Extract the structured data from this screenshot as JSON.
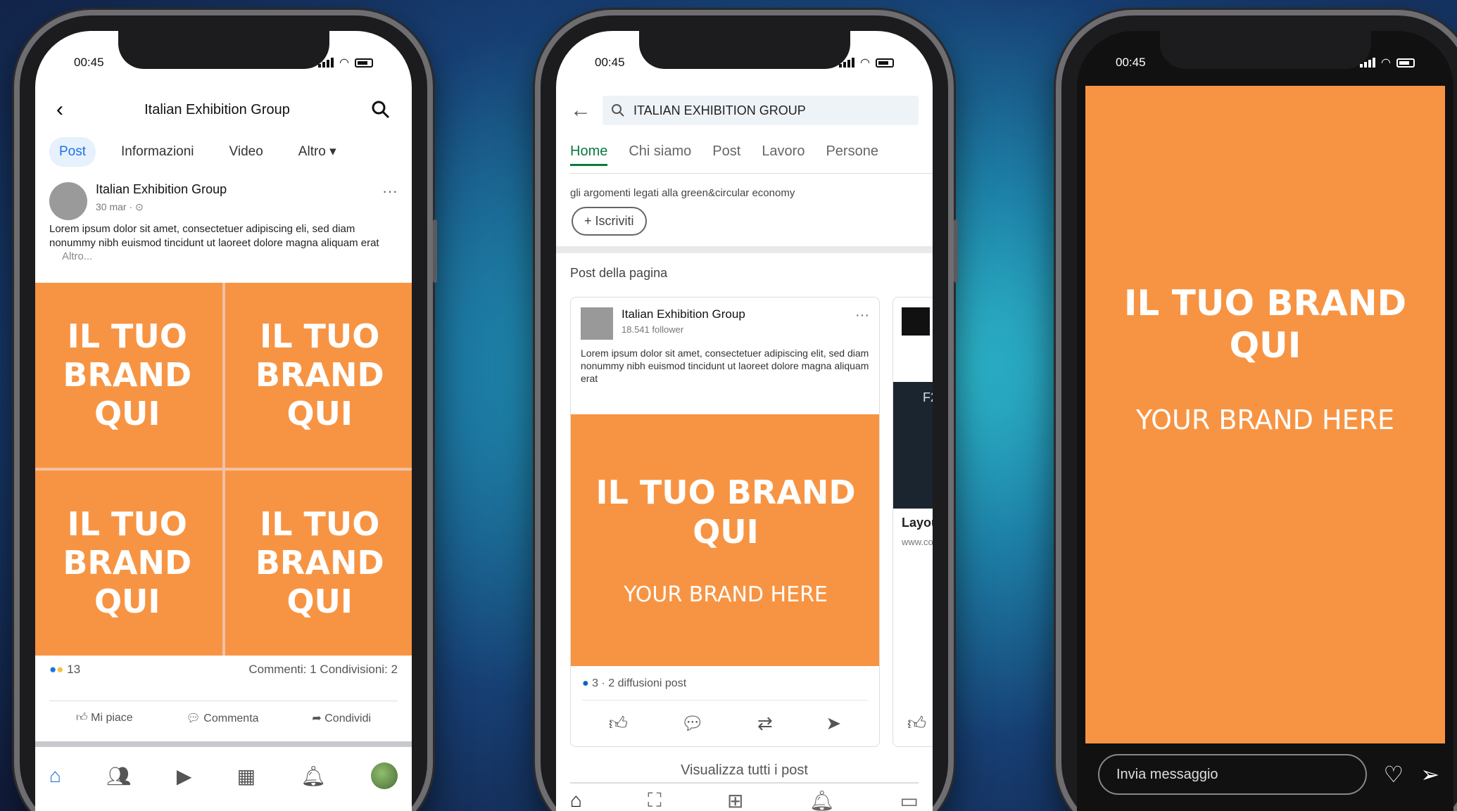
{
  "status": {
    "time": "00:45"
  },
  "facebook": {
    "page_title": "Italian Exhibition Group",
    "tabs": [
      "Post",
      "Informazioni",
      "Video",
      "Altro ▾"
    ],
    "post": {
      "author": "Italian Exhibition Group",
      "date": "30 mar · ⊙",
      "text": "Lorem ipsum dolor sit amet, consectetuer adipiscing eli, sed diam nonummy nibh euismod tincidunt ut laoreet dolore magna aliquam erat",
      "more": "Altro...",
      "brand_tiles": [
        "IL TUO BRAND QUI",
        "IL TUO BRAND QUI",
        "IL TUO BRAND QUI",
        "IL TUO BRAND QUI"
      ],
      "reactions": "13",
      "counts": "Commenti: 1   Condivisioni: 2"
    },
    "actions": [
      "Mi piace",
      "Commenta",
      "Condividi"
    ]
  },
  "linkedin": {
    "search_value": "ITALIAN EXHIBITION GROUP",
    "tabs": [
      "Home",
      "Chi siamo",
      "Post",
      "Lavoro",
      "Persone"
    ],
    "description": "gli argomenti legati alla green&circular economy",
    "follow_label": "+ Iscriviti",
    "section_title": "Post della pagina",
    "post": {
      "author": "Italian Exhibition Group",
      "followers": "18.541 follower",
      "text": "Lorem ipsum dolor sit amet, consectetuer adipiscing elit, sed diam nonummy nibh euismod tincidunt ut laoreet dolore magna aliquam erat",
      "brand_title": "IL TUO BRAND QUI",
      "brand_subtitle": "YOUR BRAND HERE",
      "stats": "3  ·  2 diffusioni post"
    },
    "next_card": {
      "title": "Layou",
      "sub": "www.co",
      "label": "F2"
    },
    "view_all": "Visualizza tutti i post"
  },
  "instagram": {
    "brand_title": "IL TUO BRAND QUI",
    "brand_subtitle": "YOUR BRAND HERE",
    "message_placeholder": "Invia messaggio"
  },
  "colors": {
    "brand_orange": "#f79443",
    "fb_blue": "#1b74e4",
    "li_green": "#0a7a3e"
  },
  "icons": [
    "back-arrow-icon",
    "search-icon",
    "more-icon",
    "like-icon",
    "comment-icon",
    "share-icon",
    "home-icon",
    "friends-icon",
    "video-icon",
    "marketplace-icon",
    "bell-icon",
    "heart-icon",
    "send-icon",
    "repost-icon"
  ]
}
